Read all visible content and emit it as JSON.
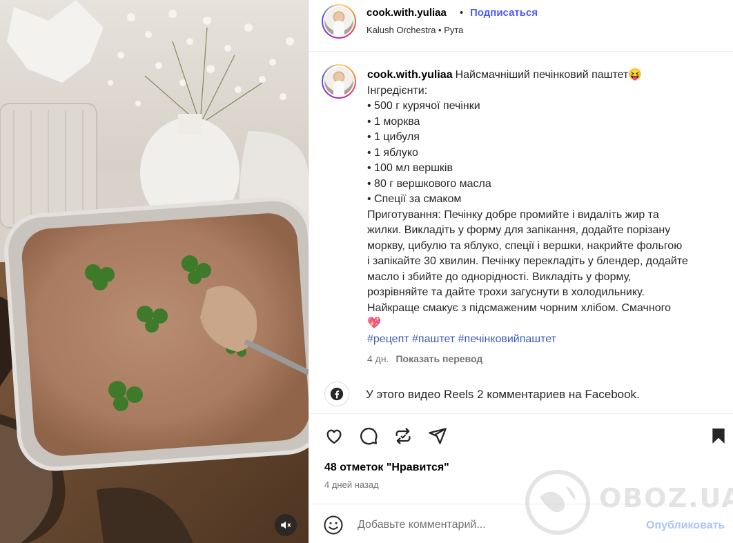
{
  "post": {
    "username": "cook.with.yuliaa",
    "follow_label": "Подписаться",
    "separator": "•",
    "audio": "Kalush Orchestra • Рута"
  },
  "caption": {
    "username": "cook.with.yuliaa",
    "lines": [
      "Найсмачніший печінковий паштет😝",
      "Інгредієнти:",
      "• 500 г курячої печінки",
      "• 1 морква",
      "• 1 цибуля",
      "• 1 яблуко",
      "• 100 мл вершків",
      "• 80 г вершкового масла",
      "• Спеції за смаком",
      "Приготування: Печінку добре промийте і видаліть жир та",
      "жилки. Викладіть у форму для запікання, додайте порізану",
      "моркву, цибулю та яблуко, спеції і вершки, накрийте фольгою",
      "і запікайте 30 хвилин. Печінку перекладіть у блендер, додайте",
      "масло і збийте до однорідності. Викладіть у форму,",
      "розрівняйте та дайте трохи загуснути в холодильнику.",
      "Найкраще смакує з підсмаженим чорним хлібом. Смачного",
      "💖"
    ],
    "hashtags": [
      "#рецепт",
      "#паштет",
      "#печінковийпаштет"
    ],
    "age": "4 дн.",
    "translate_label": "Показать перевод"
  },
  "facebook": {
    "text": "У этого видео Reels 2 комментариев на Facebook."
  },
  "engagement": {
    "likes": "48 отметок \"Нравится\"",
    "date": "4 дней назад"
  },
  "comment": {
    "placeholder": "Добавьте комментарий...",
    "publish_label": "Опубликовать"
  },
  "watermark": {
    "text": "OBOZ.UA"
  },
  "colors": {
    "link_blue": "#4a5df9",
    "hashtag_blue": "#3b5cb8",
    "publish_disabled": "#a9c6f6",
    "muted_text": "#737373"
  },
  "icons": [
    "volume-off-icon",
    "facebook-icon",
    "heart-icon",
    "comment-icon",
    "repost-icon",
    "share-icon",
    "bookmark-icon",
    "emoji-icon"
  ]
}
